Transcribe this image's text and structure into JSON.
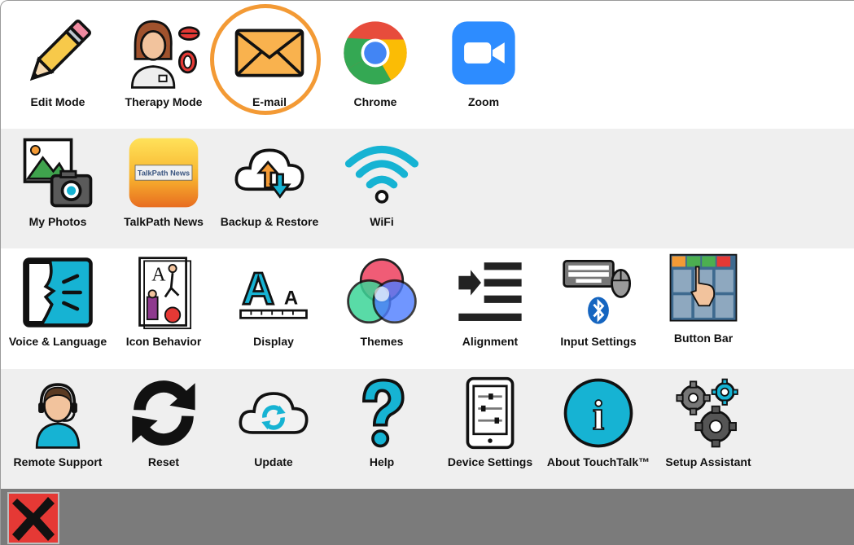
{
  "rows": [
    [
      {
        "label": "Edit Mode",
        "icon": "pencil-icon"
      },
      {
        "label": "Therapy Mode",
        "icon": "therapist-lips-icon"
      },
      {
        "label": "E-mail",
        "icon": "envelope-icon",
        "highlighted": true
      },
      {
        "label": "Chrome",
        "icon": "chrome-icon"
      },
      {
        "label": "Zoom",
        "icon": "zoom-camera-icon"
      }
    ],
    [
      {
        "label": "My Photos",
        "icon": "photos-camera-icon"
      },
      {
        "label": "TalkPath News",
        "icon": "talkpath-news-icon",
        "icon_text": "TalkPath News"
      },
      {
        "label": "Backup & Restore",
        "icon": "cloud-sync-icon"
      },
      {
        "label": "WiFi",
        "icon": "wifi-icon"
      }
    ],
    [
      {
        "label": "Voice & Language",
        "icon": "speaking-face-icon"
      },
      {
        "label": "Icon Behavior",
        "icon": "icon-behavior-icon",
        "icon_text": "A"
      },
      {
        "label": "Display",
        "icon": "font-size-icon",
        "icon_text": "A"
      },
      {
        "label": "Themes",
        "icon": "color-circles-icon"
      },
      {
        "label": "Alignment",
        "icon": "alignment-icon"
      },
      {
        "label": "Input Settings",
        "icon": "keyboard-mouse-bluetooth-icon"
      },
      {
        "label": "Button Bar",
        "icon": "button-bar-icon"
      }
    ],
    [
      {
        "label": "Remote Support",
        "icon": "headset-person-icon"
      },
      {
        "label": "Reset",
        "icon": "refresh-icon"
      },
      {
        "label": "Update",
        "icon": "cloud-update-icon"
      },
      {
        "label": "Help",
        "icon": "question-mark-icon"
      },
      {
        "label": "Device Settings",
        "icon": "tablet-settings-icon"
      },
      {
        "label": "About TouchTalk™",
        "icon": "info-icon",
        "icon_text": "i"
      },
      {
        "label": "Setup Assistant",
        "icon": "gears-icon"
      }
    ]
  ],
  "bottom_bar": {
    "close_icon": "red-x-close-icon"
  },
  "colors": {
    "accent_highlight": "#f39a35",
    "row_alt_bg": "#efefef",
    "bottom_bar_bg": "#7b7b7b",
    "close_red": "#e53935",
    "icon_teal": "#16b3d3"
  }
}
